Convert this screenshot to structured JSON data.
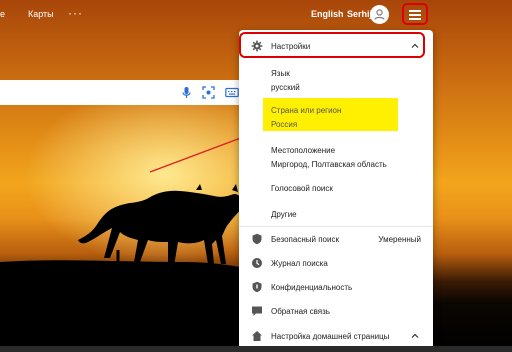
{
  "top_nav": {
    "maps_label": "Карты",
    "more_label": "···",
    "language_label": "English",
    "username": "Serhij"
  },
  "icons": {
    "menu": "hamburger-icon",
    "avatar": "user-icon",
    "mic": "microphone-icon",
    "camera": "camera-search-icon",
    "keyboard": "keyboard-icon"
  },
  "settings_menu": {
    "header_label": "Настройки",
    "items": [
      {
        "label": "Язык",
        "value": "русский"
      },
      {
        "label": "Страна или регион",
        "value": "Россия"
      },
      {
        "label": "Местоположение",
        "value": "Миргород, Полтавская область"
      },
      {
        "label": "Голосовой поиск"
      },
      {
        "label": "Другие"
      }
    ],
    "links": [
      {
        "label": "Безопасный поиск",
        "value": "Умеренный",
        "icon": "shield-icon"
      },
      {
        "label": "Журнал поиска",
        "icon": "clock-icon"
      },
      {
        "label": "Конфиденциальность",
        "icon": "shield-check-icon"
      },
      {
        "label": "Обратная связь",
        "icon": "chat-icon"
      },
      {
        "label": "Настройка домашней страницы",
        "icon": "home-icon"
      }
    ]
  },
  "colors": {
    "annotation_red": "#dd0000",
    "highlight_yellow": "#ffef00"
  }
}
